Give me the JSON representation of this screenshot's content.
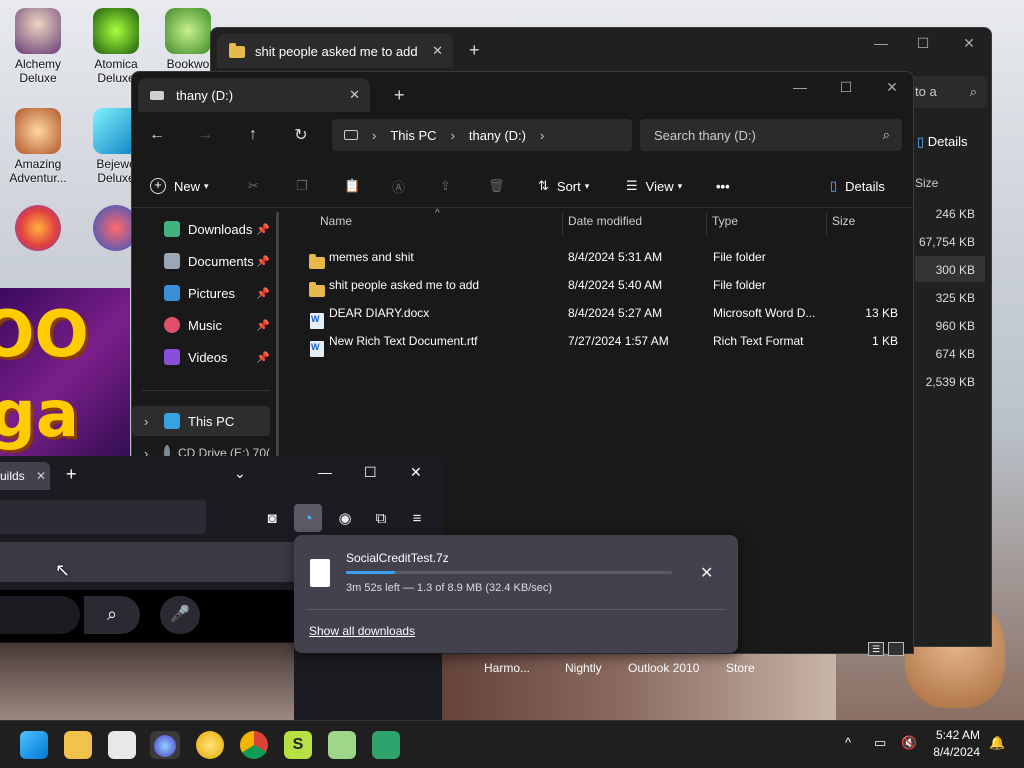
{
  "desktop": {
    "icons": [
      {
        "label": "Alchemy\nDeluxe"
      },
      {
        "label": "Atomica\nDeluxe"
      },
      {
        "label": "Bookwo"
      },
      {
        "label": "Amazing\nAdventur..."
      },
      {
        "label": "Bejewe\nDeluxe"
      },
      {
        "label": ""
      }
    ]
  },
  "back_explorer": {
    "tab_title": "shit people asked me to add",
    "search_placeholder": "to a",
    "details_label": "Details",
    "size_header": "Size",
    "sizes": [
      "246 KB",
      "67,754 KB",
      "300 KB",
      "325 KB",
      "960 KB",
      "674 KB",
      "2,539 KB"
    ]
  },
  "explorer": {
    "tab_title": "thany (D:)",
    "breadcrumb": [
      "This PC",
      "thany (D:)"
    ],
    "search_placeholder": "Search thany (D:)",
    "toolbar": {
      "new": "New",
      "sort": "Sort",
      "view": "View",
      "more": "•••",
      "details": "Details"
    },
    "sidebar": [
      {
        "label": "Downloads",
        "color": "#3fb27f"
      },
      {
        "label": "Documents",
        "color": "#9aa7b5"
      },
      {
        "label": "Pictures",
        "color": "#3b8fd9"
      },
      {
        "label": "Music",
        "color": "#e0506d"
      },
      {
        "label": "Videos",
        "color": "#8a4fd8"
      }
    ],
    "this_pc": "This PC",
    "cd_drive": "CD Drive (E:) 70(",
    "columns": {
      "name": "Name",
      "date": "Date modified",
      "type": "Type",
      "size": "Size"
    },
    "files": [
      {
        "name": "memes and shit",
        "date": "8/4/2024 5:31 AM",
        "type": "File folder",
        "size": "",
        "kind": "folder"
      },
      {
        "name": "shit people asked me to add",
        "date": "8/4/2024 5:40 AM",
        "type": "File folder",
        "size": "",
        "kind": "folder"
      },
      {
        "name": "DEAR DIARY.docx",
        "date": "8/4/2024 5:27 AM",
        "type": "Microsoft Word D...",
        "size": "13 KB",
        "kind": "doc"
      },
      {
        "name": "New Rich Text Document.rtf",
        "date": "7/27/2024 1:57 AM",
        "type": "Rich Text Format",
        "size": "1 KB",
        "kind": "doc"
      }
    ]
  },
  "firefox": {
    "tab_partial": "uilds",
    "bottom_links": [
      "Harmo...",
      "Nightly",
      "Outlook 2010",
      "Store"
    ]
  },
  "downloads": {
    "filename": "SocialCreditTest.7z",
    "status": "3m 52s left — 1.3 of 8.9 MB (32.4 KB/sec)",
    "progress": 0.15,
    "show_all": "Show all downloads"
  },
  "taskbar": {
    "time": "5:42 AM",
    "date": "8/4/2024"
  }
}
